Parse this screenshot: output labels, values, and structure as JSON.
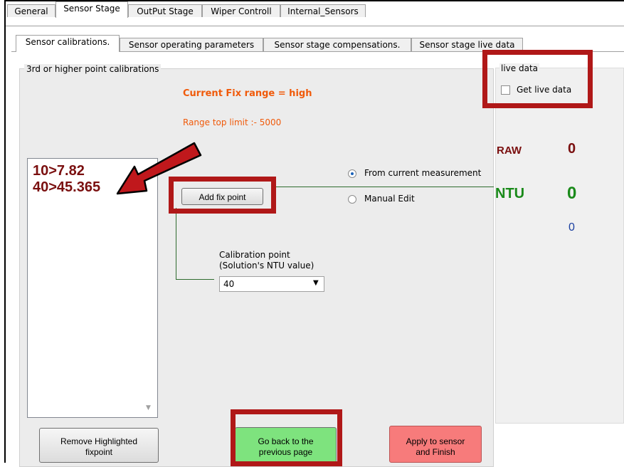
{
  "main_tabs": [
    {
      "label": "General",
      "active": false
    },
    {
      "label": "Sensor Stage",
      "active": true
    },
    {
      "label": "OutPut Stage",
      "active": false
    },
    {
      "label": "Wiper Controll",
      "active": false
    },
    {
      "label": "Internal_Sensors",
      "active": false
    }
  ],
  "sub_tabs": [
    {
      "label": "Sensor calibrations.",
      "active": true
    },
    {
      "label": "Sensor operating parameters",
      "active": false
    },
    {
      "label": "Sensor stage compensations.",
      "active": false
    },
    {
      "label": "Sensor stage live data",
      "active": false
    }
  ],
  "calibration": {
    "group_title": "3rd or higher point calibrations",
    "fix_range_title": "Current  Fix range = high",
    "range_limit": "Range top limit :-   5000",
    "fix_points": [
      "10>7.82",
      "40>45.365"
    ],
    "add_button": "Add fix point",
    "source_options": [
      {
        "label": "From current measurement",
        "selected": true
      },
      {
        "label": "Manual Edit",
        "selected": false
      }
    ],
    "cal_point_label_1": "Calibration point",
    "cal_point_label_2": "(Solution's NTU value)",
    "cal_point_value": "40",
    "remove_button_1": "Remove Highlighted",
    "remove_button_2": "fixpoint",
    "back_button_1": "Go back to the",
    "back_button_2": "previous page",
    "apply_button_1": "Apply to sensor",
    "apply_button_2": "and Finish"
  },
  "live": {
    "group_title": "live data",
    "checkbox_label": "Get live data",
    "checked": false,
    "raw_label": "RAW",
    "raw_value": "0",
    "ntu_label": "NTU",
    "ntu_value": "0",
    "ntu_secondary": "0"
  },
  "colors": {
    "highlight_box": "#b01818",
    "arrow": "#c0181c",
    "fix_point_text": "#7a0f0f",
    "orange_text": "#f05a0a",
    "ntu_green": "#1a8a1a",
    "back_button_bg": "#7ee37e",
    "apply_button_bg": "#f77b7b"
  }
}
